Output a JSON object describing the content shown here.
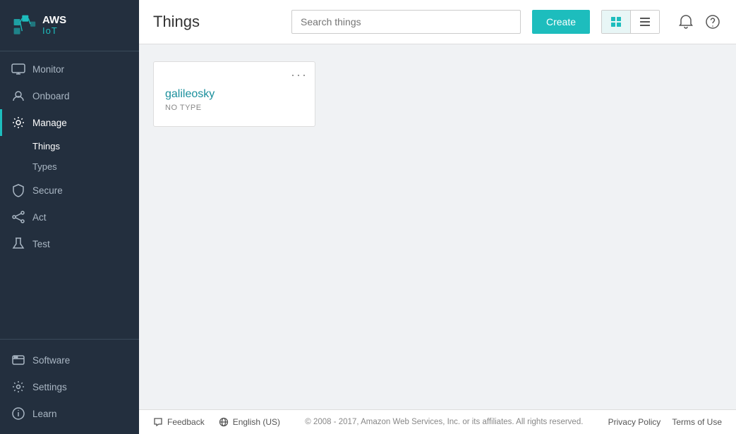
{
  "brand": {
    "aws": "AWS",
    "iot": "IoT"
  },
  "sidebar": {
    "items": [
      {
        "id": "monitor",
        "label": "Monitor",
        "icon": "monitor"
      },
      {
        "id": "onboard",
        "label": "Onboard",
        "icon": "onboard"
      },
      {
        "id": "manage",
        "label": "Manage",
        "icon": "manage",
        "active": true,
        "expanded": true,
        "children": [
          {
            "id": "things",
            "label": "Things",
            "active": true
          },
          {
            "id": "types",
            "label": "Types"
          }
        ]
      },
      {
        "id": "secure",
        "label": "Secure",
        "icon": "secure"
      },
      {
        "id": "act",
        "label": "Act",
        "icon": "act"
      },
      {
        "id": "test",
        "label": "Test",
        "icon": "test"
      }
    ],
    "footer_items": [
      {
        "id": "software",
        "label": "Software",
        "icon": "software"
      },
      {
        "id": "settings",
        "label": "Settings",
        "icon": "settings"
      },
      {
        "id": "learn",
        "label": "Learn",
        "icon": "learn"
      }
    ]
  },
  "header": {
    "title": "Things",
    "search_placeholder": "Search things",
    "create_label": "Create",
    "view_grid_label": "Grid view",
    "view_list_label": "List view"
  },
  "things": [
    {
      "name": "galileosky",
      "type_label": "NO TYPE"
    }
  ],
  "footer": {
    "feedback_label": "Feedback",
    "language_label": "English (US)",
    "copyright": "© 2008 - 2017, Amazon Web Services, Inc. or its affiliates. All rights reserved.",
    "privacy_policy": "Privacy Policy",
    "terms_of_use": "Terms of Use"
  }
}
